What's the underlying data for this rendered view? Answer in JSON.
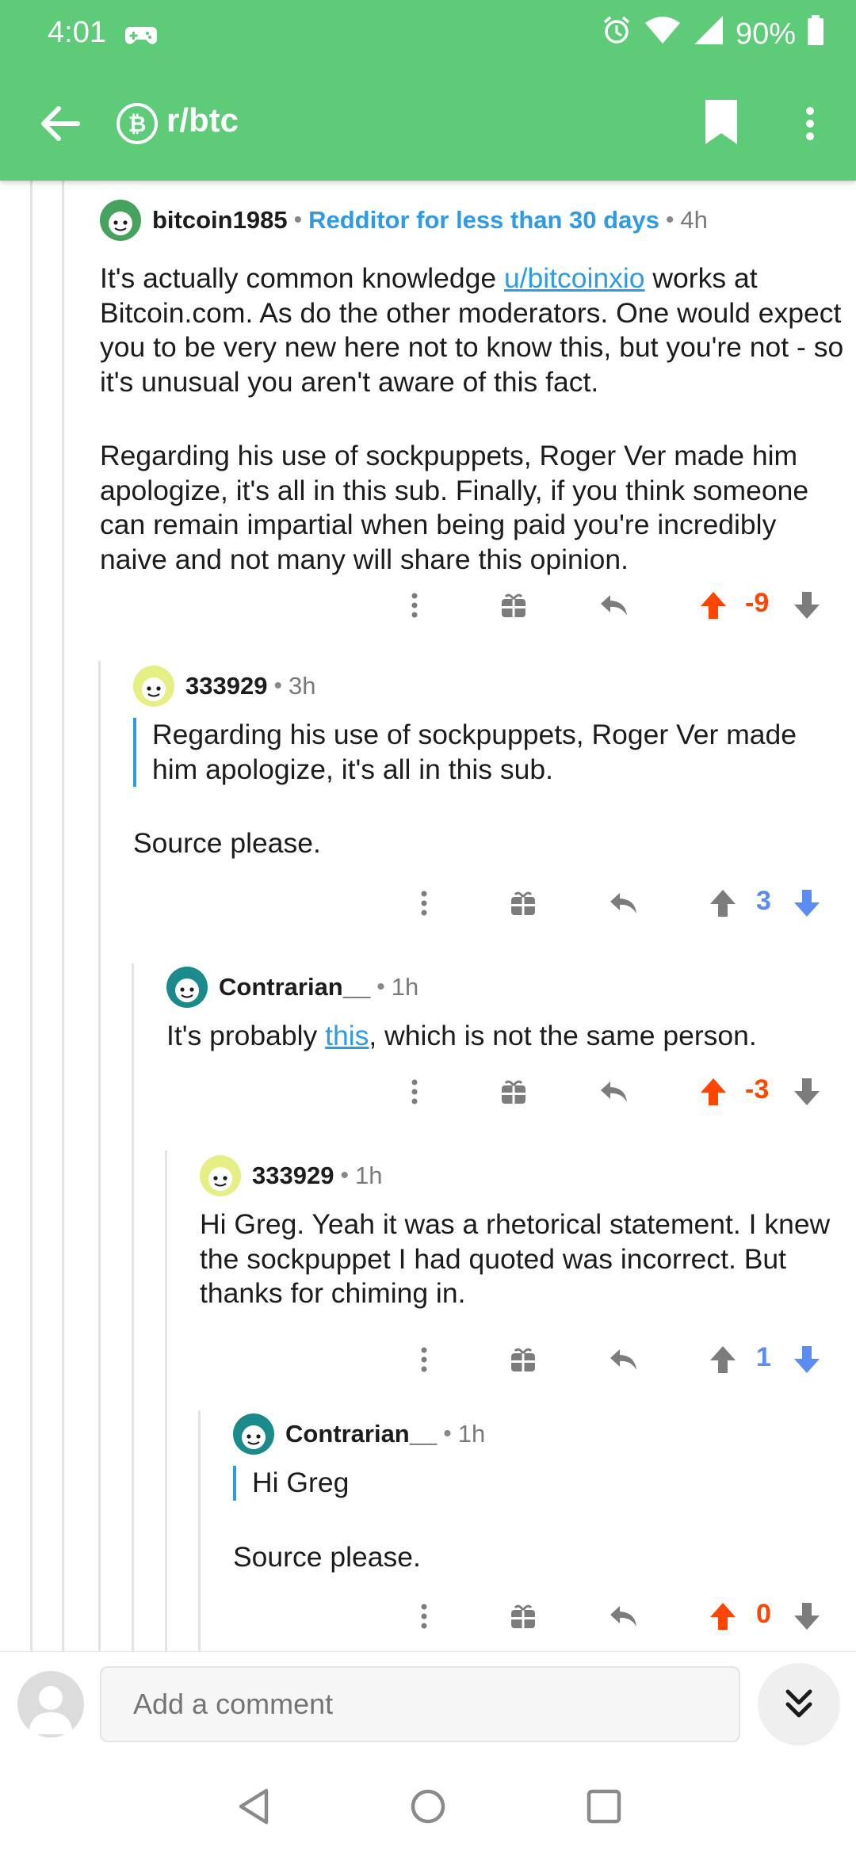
{
  "status_bar": {
    "time": "4:01",
    "battery": "90%"
  },
  "toolbar": {
    "subreddit": "r/btc"
  },
  "colors": {
    "accent": "#5ecb79",
    "link": "#2f9be4",
    "upvote": "#ff4500",
    "downvote": "#5a8cf2",
    "neutral_icon": "#7c7c7c"
  },
  "comments": [
    {
      "author": "bitcoin1985",
      "flair": "Redditor for less than 30 days",
      "age": "4h",
      "body_p1_a": "It's actually common knowledge ",
      "body_p1_link": "u/bitcoinxio",
      "body_p1_b": " works at Bitcoin.com. As do the other moderators. One would expect you to be very new here not to know this, but you're not - so it's unusual you aren't aware of this fact.",
      "body_p2": "Regarding his use of sockpuppets, Roger Ver made him apologize, it's all in this sub. Finally, if you think someone can remain impartial when being paid you're incredibly naive and not many will share this opinion.",
      "score": "-9",
      "vote": "up"
    },
    {
      "author": "333929",
      "age": "3h",
      "quote": "Regarding his use of sockpuppets, Roger Ver made him apologize, it's all in this sub.",
      "body": "Source please.",
      "score": "3",
      "vote": "down"
    },
    {
      "author": "Contrarian__",
      "age": "1h",
      "body_a": "It's probably ",
      "body_link": "this",
      "body_b": ", which is not the same person.",
      "score": "-3",
      "vote": "up"
    },
    {
      "author": "333929",
      "age": "1h",
      "body": "Hi Greg. Yeah it was a rhetorical statement. I knew the sockpuppet I had quoted was incorrect. But thanks for chiming in.",
      "score": "1",
      "vote": "down"
    },
    {
      "author": "Contrarian__",
      "age": "1h",
      "quote": "Hi Greg",
      "body": "Source please.",
      "score": "0",
      "vote": "up"
    }
  ],
  "composer": {
    "placeholder": "Add a comment"
  },
  "icons": [
    "back-arrow-icon",
    "bitcoin-icon",
    "bookmark-icon",
    "more-vert-icon",
    "gift-icon",
    "reply-icon",
    "upvote-icon",
    "downvote-icon",
    "chevron-double-down-icon",
    "nav-back-icon",
    "nav-home-icon",
    "nav-recents-icon"
  ]
}
